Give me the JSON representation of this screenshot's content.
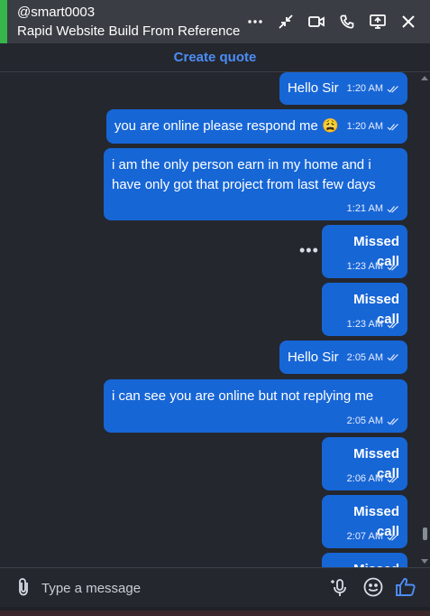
{
  "header": {
    "username": "@smart0003",
    "project": "Rapid Website Build From Reference",
    "accent_color": "#36b54a",
    "icons": [
      "more-icon",
      "minimize-icon",
      "video-call-icon",
      "phone-icon",
      "screen-share-icon",
      "close-icon"
    ]
  },
  "quote": {
    "label": "Create quote",
    "color": "#4c8df6"
  },
  "messages": [
    {
      "type": "text",
      "text": "Hello Sir",
      "time": "1:20 AM"
    },
    {
      "type": "text",
      "text": "you are online please respond me 😩",
      "time": "1:20 AM"
    },
    {
      "type": "text",
      "text": "i am the only person earn in my home and i have only got that project from last few days",
      "time": "1:21 AM"
    },
    {
      "type": "missed",
      "text": "Missed call",
      "time": "1:23 AM"
    },
    {
      "type": "missed",
      "text": "Missed call",
      "time": "1:23 AM"
    },
    {
      "type": "text",
      "text": "Hello Sir",
      "time": "2:05 AM"
    },
    {
      "type": "text",
      "text": "i can see you are online but not replying me",
      "time": "2:05 AM"
    },
    {
      "type": "missed",
      "text": "Missed call",
      "time": "2:06 AM"
    },
    {
      "type": "missed",
      "text": "Missed call",
      "time": "2:07 AM"
    },
    {
      "type": "missed",
      "text": "Missed call",
      "time": ""
    }
  ],
  "bubble_color": "#1766d6",
  "composer": {
    "placeholder": "Type a message",
    "icons": [
      "paperclip-icon",
      "voice-message-icon",
      "emoji-icon",
      "thumbs-up-icon"
    ]
  }
}
